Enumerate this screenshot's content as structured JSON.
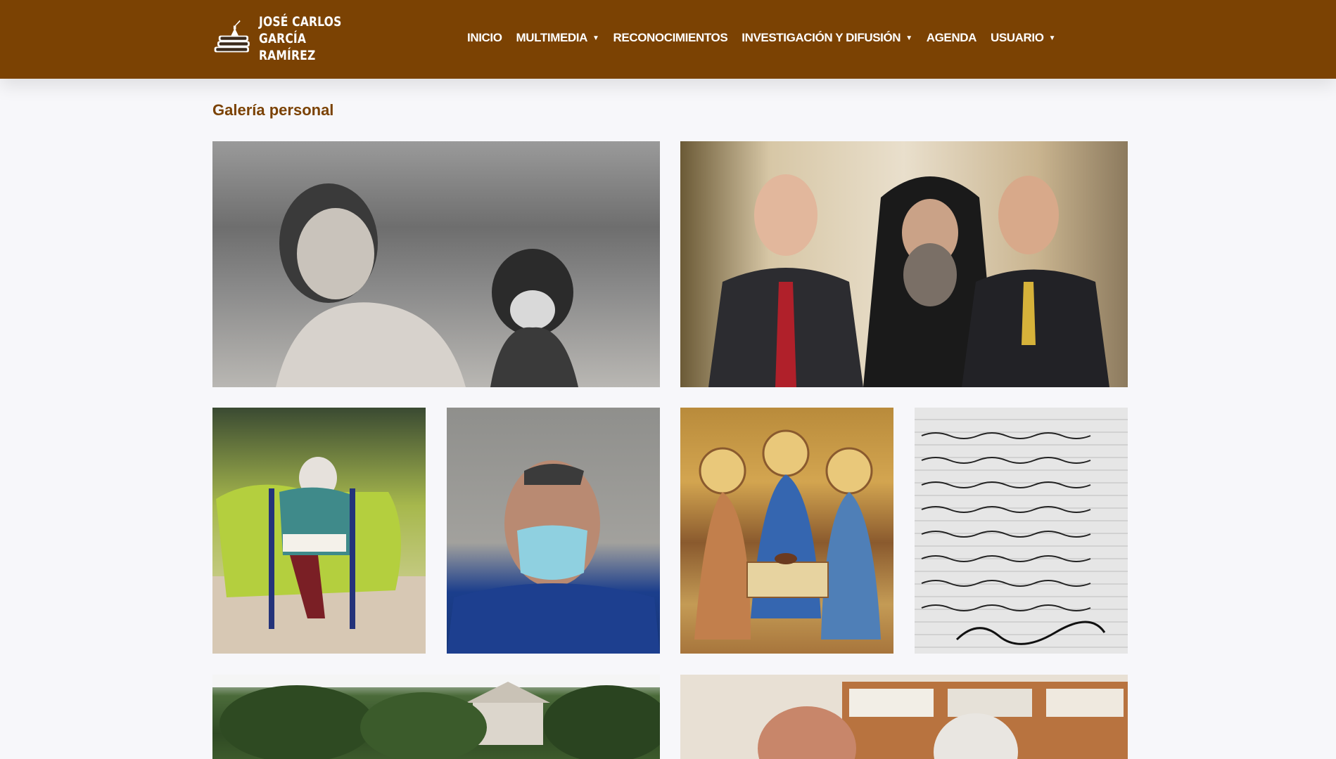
{
  "brand": {
    "line1": "JOSÉ CARLOS",
    "line2": "GARCÍA RAMÍREZ"
  },
  "nav": {
    "items": [
      {
        "label": "INICIO",
        "dropdown": false
      },
      {
        "label": "MULTIMEDIA",
        "dropdown": true
      },
      {
        "label": "RECONOCIMIENTOS",
        "dropdown": false
      },
      {
        "label": "INVESTIGACIÓN Y DIFUSIÓN",
        "dropdown": true
      },
      {
        "label": "AGENDA",
        "dropdown": false
      },
      {
        "label": "USUARIO",
        "dropdown": true
      }
    ]
  },
  "page": {
    "title": "Galería personal"
  },
  "colors": {
    "brand_brown": "#7b4203",
    "background": "#f7f7fa"
  }
}
